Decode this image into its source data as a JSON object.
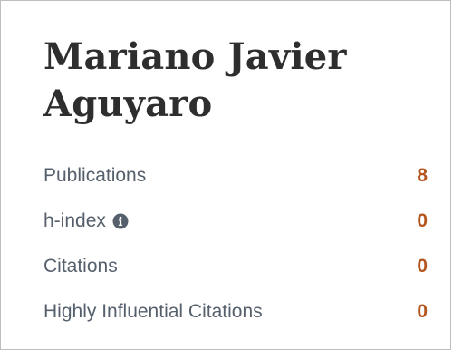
{
  "author": {
    "name": "Mariano Javier Aguyaro"
  },
  "stats": [
    {
      "label": "Publications",
      "value": "8"
    },
    {
      "label": "h-index",
      "value": "0"
    },
    {
      "label": "Citations",
      "value": "0"
    },
    {
      "label": "Highly Influential Citations",
      "value": "0"
    }
  ],
  "colors": {
    "value": "#b5561f",
    "label": "#56606c",
    "name": "#2e2e2e",
    "border": "#bdbdbd"
  },
  "icons": {
    "h_index_info": "info-icon"
  }
}
